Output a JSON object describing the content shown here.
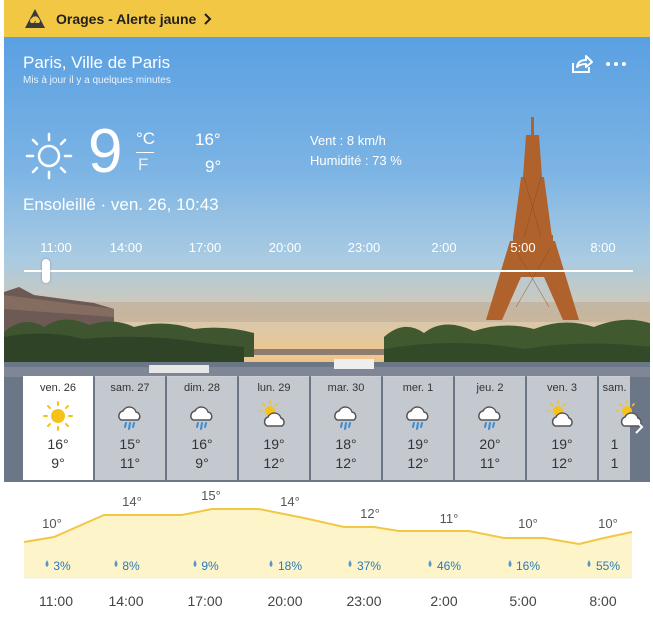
{
  "alert": {
    "label": "Orages - Alerte jaune",
    "color": "#f2c744"
  },
  "header": {
    "location": "Paris, Ville de Paris",
    "updated": "Mis à jour il y a quelques minutes"
  },
  "current": {
    "temp": "9",
    "unit_c": "°C",
    "unit_f": "F",
    "high": "16°",
    "low": "9°",
    "wind": "Vent : 8 km/h",
    "humidity": "Humidité : 73 %",
    "condition": "Ensoleillé · ven. 26, 10:43",
    "icon": "sun-icon"
  },
  "timeline": {
    "labels": [
      "11:00",
      "14:00",
      "17:00",
      "20:00",
      "23:00",
      "2:00",
      "5:00",
      "8:00"
    ],
    "position": 0.0
  },
  "days": [
    {
      "name": "ven. 26",
      "icon": "sun",
      "high": "16°",
      "low": "9°",
      "selected": true
    },
    {
      "name": "sam. 27",
      "icon": "rain",
      "high": "15°",
      "low": "11°"
    },
    {
      "name": "dim. 28",
      "icon": "rain",
      "high": "16°",
      "low": "9°"
    },
    {
      "name": "lun. 29",
      "icon": "partly-cloudy",
      "high": "19°",
      "low": "12°"
    },
    {
      "name": "mar. 30",
      "icon": "rain",
      "high": "18°",
      "low": "12°"
    },
    {
      "name": "mer. 1",
      "icon": "rain",
      "high": "19°",
      "low": "12°"
    },
    {
      "name": "jeu. 2",
      "icon": "rain",
      "high": "20°",
      "low": "11°"
    },
    {
      "name": "ven. 3",
      "icon": "partly-cloudy",
      "high": "19°",
      "low": "12°"
    },
    {
      "name": "sam.",
      "icon": "partly-cloudy",
      "high": "1",
      "low": "1"
    }
  ],
  "hourly": {
    "temps": [
      "10°",
      "14°",
      "15°",
      "14°",
      "12°",
      "11°",
      "10°",
      "10°"
    ],
    "rain": [
      "3%",
      "8%",
      "9%",
      "18%",
      "37%",
      "46%",
      "16%",
      "55%"
    ],
    "times": [
      "11:00",
      "14:00",
      "17:00",
      "20:00",
      "23:00",
      "2:00",
      "5:00",
      "8:00"
    ]
  },
  "colors": {
    "graph_line": "#f2c744",
    "graph_fill": "#fdf4c9",
    "rain_text": "#2b79b8"
  }
}
